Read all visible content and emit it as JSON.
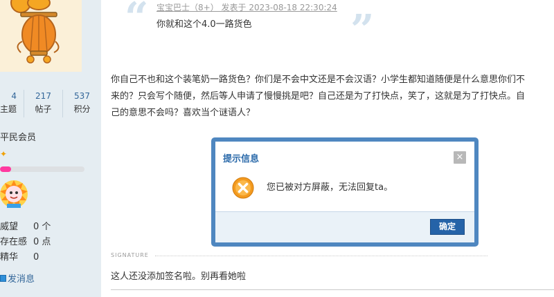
{
  "sidebar": {
    "stats": [
      {
        "value": "4",
        "label": "主题"
      },
      {
        "value": "217",
        "label": "帖子"
      },
      {
        "value": "537",
        "label": "积分"
      }
    ],
    "member_level": "平民会员",
    "level_progress_percent": 13,
    "properties": [
      {
        "key": "威望",
        "value": "0 个"
      },
      {
        "key": "存在感",
        "value": "0 点"
      },
      {
        "key": "精华",
        "value": "0"
      }
    ],
    "send_message": "发消息"
  },
  "quote": {
    "meta": "宝宝巴士（8+） 发表于 2023-08-18 22:30:24",
    "text": "你就和这个4.0一路货色"
  },
  "post": {
    "lines": [
      "你自己不也和这个装笔奶一路货色？你们是不会中文还是不会汉语？小学生都知道随便是什么意思你们不",
      "来的？只会写个随便，然后等人申请了慢慢挑是吧？自己还是为了打快点，笑了，这就是为了打快点。自",
      "己的意思不会吗？喜欢当个谜语人？"
    ]
  },
  "signature": {
    "label": "SIGNATURE",
    "text": "这人还没添加签名啦。别再看她啦"
  },
  "dialog": {
    "title": "提示信息",
    "close": "×",
    "message": "您已被对方屏蔽，无法回复ta。",
    "confirm_label": "确定"
  },
  "colors": {
    "sidebar_bg": "#e5edf2",
    "dialog_border": "#4f87c0",
    "dialog_title": "#2b6aaa",
    "confirm_bg": "#2563a8",
    "progress_fill": "#ff3aa0",
    "error_icon": "#f39a1f",
    "link": "#336699"
  },
  "icons": [
    "lantern-avatar-icon",
    "level-star-icon",
    "medal-icon",
    "message-icon",
    "quote-open-icon",
    "quote-close-icon",
    "error-icon",
    "close-icon"
  ]
}
